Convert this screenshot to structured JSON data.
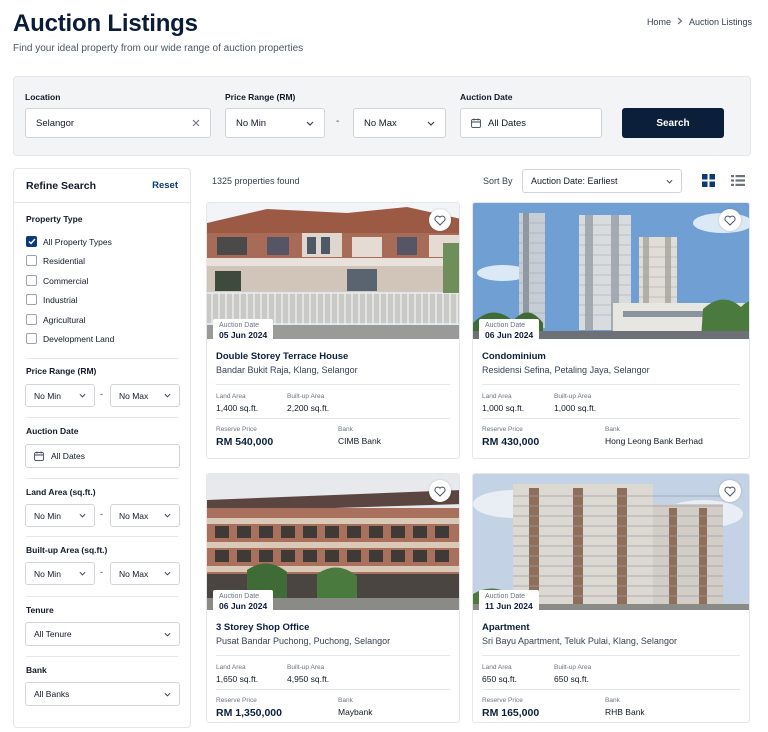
{
  "header": {
    "title": "Auction Listings",
    "subtitle": "Find your ideal property from our wide range of auction properties",
    "breadcrumb": [
      "Home",
      "Auction Listings"
    ]
  },
  "search": {
    "location_label": "Location",
    "location_value": "Selangor",
    "price_label": "Price Range (RM)",
    "price_min": "No Min",
    "price_max": "No Max",
    "price_separator": "-",
    "date_label": "Auction Date",
    "date_value": "All Dates",
    "search_button": "Search"
  },
  "sidebar": {
    "title": "Refine Search",
    "reset": "Reset",
    "property_type_title": "Property Type",
    "property_types": [
      {
        "label": "All Property Types",
        "checked": true
      },
      {
        "label": "Residential",
        "checked": false
      },
      {
        "label": "Commercial",
        "checked": false
      },
      {
        "label": "Industrial",
        "checked": false
      },
      {
        "label": "Agricultural",
        "checked": false
      },
      {
        "label": "Development Land",
        "checked": false
      }
    ],
    "price_title": "Price Range (RM)",
    "price_min": "No Min",
    "price_max": "No Max",
    "date_title": "Auction Date",
    "date_value": "All Dates",
    "land_title": "Land Area (sq.ft.)",
    "land_min": "No Min",
    "land_max": "No Max",
    "built_title": "Built-up Area (sq.ft.)",
    "built_min": "No Min",
    "built_max": "No Max",
    "tenure_title": "Tenure",
    "tenure_value": "All Tenure",
    "bank_title": "Bank",
    "bank_value": "All Banks",
    "separator": "-"
  },
  "results": {
    "count_text": "1325 properties found",
    "sort_label": "Sort By",
    "sort_value": "Auction Date: Earliest"
  },
  "labels": {
    "auction_date": "Auction Date",
    "land_area": "Land Area",
    "built_up_area": "Built-up Area",
    "reserve_price": "Reserve Price",
    "bank": "Bank"
  },
  "listings": [
    {
      "date": "05 Jun 2024",
      "title": "Double Storey Terrace House",
      "location": "Bandar Bukit Raja, Klang, Selangor",
      "land_area": "1,400 sq.ft.",
      "built_up": "2,200 sq.ft.",
      "price": "RM 540,000",
      "bank": "CIMB Bank"
    },
    {
      "date": "06 Jun 2024",
      "title": "Condominium",
      "location": "Residensi Sefina, Petaling Jaya, Selangor",
      "land_area": "1,000 sq.ft.",
      "built_up": "1,000 sq.ft.",
      "price": "RM 430,000",
      "bank": "Hong Leong Bank Berhad"
    },
    {
      "date": "06 Jun 2024",
      "title": "3 Storey Shop Office",
      "location": "Pusat Bandar Puchong, Puchong, Selangor",
      "land_area": "1,650 sq.ft.",
      "built_up": "4,950 sq.ft.",
      "price": "RM 1,350,000",
      "bank": "Maybank"
    },
    {
      "date": "11 Jun 2024",
      "title": "Apartment",
      "location": "Sri Bayu Apartment, Teluk Pulai, Klang, Selangor",
      "land_area": "650 sq.ft.",
      "built_up": "650 sq.ft.",
      "price": "RM 165,000",
      "bank": "RHB Bank"
    }
  ],
  "colors": {
    "primary": "#0b1f3a",
    "link": "#0b3a7a"
  }
}
